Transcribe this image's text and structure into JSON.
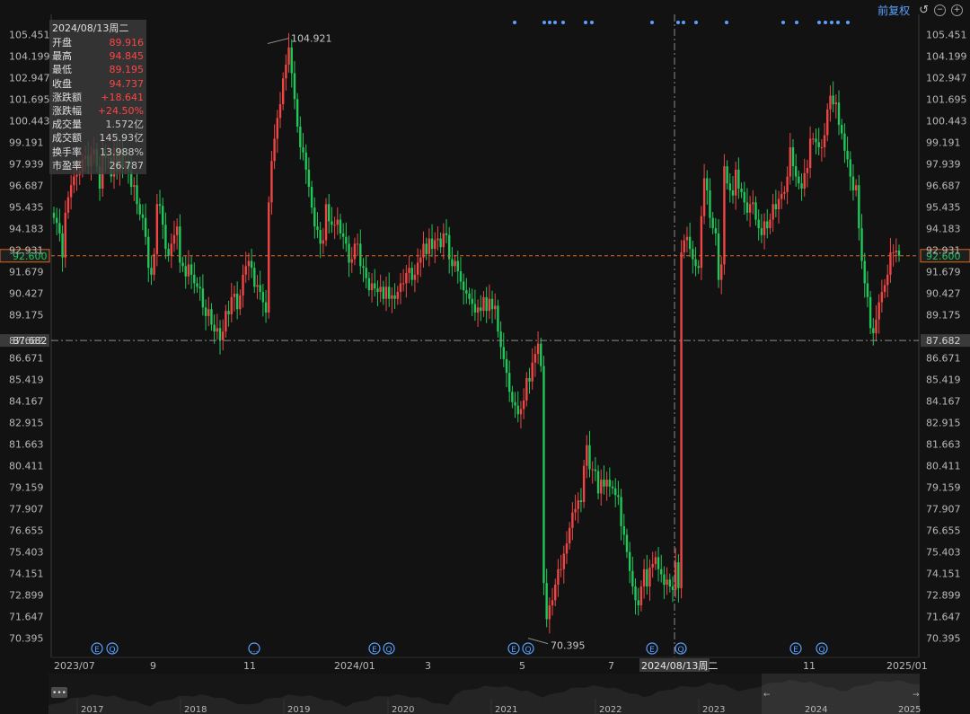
{
  "toolbar": {
    "adjust_label": "前复权",
    "reset_icon": "reset-icon",
    "zoom_out_icon": "minus-icon",
    "zoom_in_icon": "plus-icon"
  },
  "tooltip": {
    "date": "2024/08/13周二",
    "rows": [
      {
        "label": "开盘",
        "value": "89.916",
        "color": "red"
      },
      {
        "label": "最高",
        "value": "94.845",
        "color": "red"
      },
      {
        "label": "最低",
        "value": "89.195",
        "color": "red"
      },
      {
        "label": "收盘",
        "value": "94.737",
        "color": "red"
      },
      {
        "label": "涨跌额",
        "value": "+18.641",
        "color": "red"
      },
      {
        "label": "涨跌幅",
        "value": "+24.50%",
        "color": "red"
      },
      {
        "label": "成交量",
        "value": "1.572亿",
        "color": "gray"
      },
      {
        "label": "成交额",
        "value": "145.93亿",
        "color": "gray"
      },
      {
        "label": "换手率",
        "value": "13.988%",
        "color": "gray"
      },
      {
        "label": "市盈率",
        "value": "26.787",
        "color": "gray"
      }
    ]
  },
  "chart_data": {
    "type": "candlestick",
    "colors": {
      "up": "#f04545",
      "down": "#1ec85a",
      "background": "#121212",
      "grid": "#2a2a2a",
      "accent": "#5aa0ff",
      "price_line": "#e0641e"
    },
    "y_ticks": [
      "105.451",
      "104.199",
      "102.947",
      "101.695",
      "100.443",
      "99.191",
      "97.939",
      "96.687",
      "95.435",
      "94.183",
      "92.931",
      "91.679",
      "90.427",
      "89.175",
      "87.682",
      "86.671",
      "85.419",
      "84.167",
      "82.915",
      "81.663",
      "80.411",
      "79.159",
      "77.907",
      "76.655",
      "75.403",
      "74.151",
      "72.899",
      "71.647",
      "70.395"
    ],
    "ylim": [
      69.8,
      106.2
    ],
    "x_labels": [
      "2023/07",
      "9",
      "11",
      "2024/01",
      "3",
      "5",
      "7",
      "2024/08/13周二",
      "11",
      "2025/01"
    ],
    "current_price": {
      "value": 92.6,
      "label": "92.600"
    },
    "crosshair": {
      "value": 87.682,
      "label": "87.682",
      "x_label": "2024/08/13周二"
    },
    "annotations": [
      {
        "label": "104.921",
        "value": 104.921
      },
      {
        "label": "70.395",
        "value": 70.395
      }
    ],
    "event_markers": [
      "E",
      "Q",
      "…",
      "E",
      "Q",
      "E",
      "Q",
      "E",
      "Q",
      "E",
      "Q"
    ],
    "navigator_years": [
      "2017",
      "2018",
      "2019",
      "2020",
      "2021",
      "2022",
      "2023",
      "2024",
      "2025"
    ],
    "navigator_menu_icon": "more-icon",
    "closes": [
      94.8,
      94.5,
      93.9,
      92.5,
      95.1,
      96,
      96.7,
      97.2,
      97.3,
      97.5,
      98.2,
      98.4,
      97.8,
      98.5,
      98.8,
      97.8,
      96.5,
      98.6,
      98.3,
      98.3,
      97.2,
      98.9,
      97.5,
      98.8,
      97.7,
      98.1,
      97.5,
      96.6,
      96.7,
      95.6,
      95,
      94.8,
      93.7,
      91.9,
      91.5,
      92.7,
      95.6,
      95.5,
      94.4,
      93,
      92.6,
      93.3,
      93.8,
      94.3,
      92.2,
      92,
      91.4,
      92.1,
      91.5,
      91,
      90.8,
      90.7,
      89.6,
      89.1,
      89.5,
      88.6,
      88.2,
      88.4,
      87.7,
      88.2,
      89.4,
      89.2,
      90.2,
      90.4,
      89.5,
      90.3,
      91.5,
      92,
      92.3,
      91.9,
      90.8,
      90.9,
      90.5,
      89.9,
      89.3,
      95.7,
      98.1,
      99.4,
      100.6,
      101.4,
      102.9,
      103.7,
      104.7,
      103.2,
      101.7,
      100.1,
      98.9,
      98.6,
      97.6,
      96.6,
      95.4,
      94.3,
      94.1,
      93.3,
      93.5,
      95.6,
      94.6,
      94.4,
      94.4,
      94.7,
      93.9,
      93.7,
      93.3,
      92.2,
      92.4,
      93.3,
      93.3,
      92,
      91.9,
      91.3,
      90.6,
      91,
      90.7,
      90.5,
      90.8,
      90.1,
      90.8,
      90.1,
      90.3,
      90.1,
      90.5,
      91,
      91,
      91.6,
      91.9,
      91.2,
      91.5,
      92.2,
      92.5,
      93.3,
      92.7,
      93.6,
      93,
      93.5,
      93.6,
      93.1,
      93.9,
      93.8,
      92.4,
      92,
      92.3,
      91.7,
      91.1,
      90.6,
      90.4,
      90.1,
      89.8,
      89.3,
      89.6,
      89.4,
      90.2,
      89.4,
      90.1,
      89.5,
      89.7,
      88.2,
      87.3,
      86.6,
      85.8,
      84.7,
      84.1,
      83.9,
      83.4,
      83.7,
      84.2,
      85.5,
      85.3,
      86.4,
      86.9,
      87.5,
      86.2,
      73.6,
      71.5,
      72.3,
      72.6,
      73.5,
      74.4,
      74.4,
      75.3,
      75.9,
      76.8,
      77.7,
      77.9,
      78.4,
      78.3,
      80.4,
      81.6,
      80.2,
      80.2,
      80.1,
      78.8,
      79.6,
      79.2,
      79.6,
      79.2,
      79.1,
      78.7,
      78.6,
      76.9,
      76.4,
      75.4,
      74.3,
      73.4,
      72.6,
      72.3,
      73.4,
      74.4,
      73.4,
      74.5,
      74.7,
      75.1,
      74.4,
      74.1,
      73.5,
      73.8,
      73.4,
      73.2,
      74.8,
      73.3,
      92.8,
      93.5,
      93.7,
      93,
      92.4,
      92,
      91.9,
      94.9,
      97.1,
      96.4,
      94.8,
      94.2,
      93.9,
      91.2,
      92.1,
      97.8,
      96.8,
      96.4,
      96.1,
      97.6,
      96.5,
      96.3,
      95.7,
      95.1,
      95.6,
      95.7,
      94.7,
      94.2,
      93.8,
      94.6,
      94.2,
      94.7,
      95.6,
      95.3,
      95.9,
      96.2,
      96.3,
      97.2,
      98.9,
      97.8,
      97.2,
      96.8,
      96.5,
      97.4,
      97.7,
      99.4,
      99.4,
      99.2,
      98.9,
      98.9,
      99.6,
      101.1,
      101.9,
      101.4,
      101.5,
      100.2,
      99.7,
      98.7,
      98.2,
      97.2,
      96.4,
      96.7,
      94.2,
      92.3,
      91,
      90.2,
      88.4,
      88.1,
      88.9,
      89.9,
      90.5,
      90.9,
      91.5,
      92.8,
      92.8,
      92.9,
      92.6
    ]
  }
}
